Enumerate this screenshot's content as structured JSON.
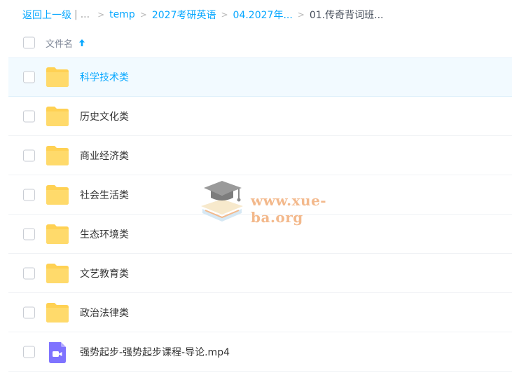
{
  "breadcrumb": {
    "back_label": "返回上一级",
    "divider": "|",
    "ellipsis": "...",
    "crumbs": [
      "temp",
      "2027考研英语",
      "04.2027年..."
    ],
    "current": "01.传奇背词班..."
  },
  "header": {
    "column_name": "文件名",
    "sort": "ascending"
  },
  "files": [
    {
      "name": "科学技术类",
      "type": "folder",
      "active": true
    },
    {
      "name": "历史文化类",
      "type": "folder"
    },
    {
      "name": "商业经济类",
      "type": "folder"
    },
    {
      "name": "社会生活类",
      "type": "folder"
    },
    {
      "name": "生态环境类",
      "type": "folder"
    },
    {
      "name": "文艺教育类",
      "type": "folder"
    },
    {
      "name": "政治法律类",
      "type": "folder"
    },
    {
      "name": "强势起步-强势起步课程-导论.mp4",
      "type": "video"
    }
  ],
  "watermark": {
    "text": "www.xue-ba.org"
  },
  "colors": {
    "link": "#06a7ff",
    "folder": "#ffd153",
    "video": "#7f73ff",
    "active_row": "#f2faff"
  }
}
